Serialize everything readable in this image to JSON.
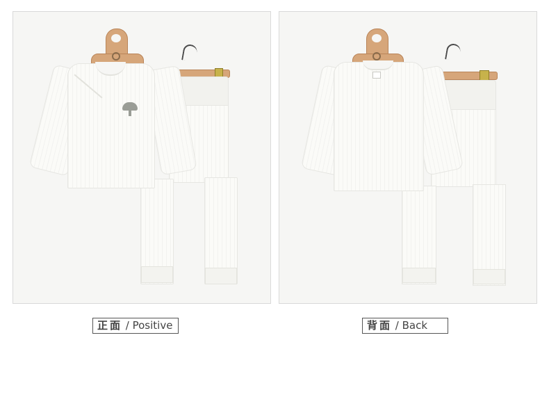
{
  "views": [
    {
      "id": "front",
      "caption_cn": "正面",
      "caption_en": "/ Positive",
      "hanger_logo": "C",
      "shirt_badge": "mushroom"
    },
    {
      "id": "back",
      "caption_cn": "背面",
      "caption_en": "/ Back",
      "hanger_logo": "C",
      "shirt_badge": "label"
    }
  ],
  "colors": {
    "background": "#ffffff",
    "panel_background": "#f6f6f4",
    "panel_border": "#d9d9d9",
    "garment": "#fbfbf8",
    "hanger_wood": "#d6a67a",
    "clip_gold": "#c7b24b",
    "caption_border": "#555555",
    "caption_text": "#444444"
  }
}
